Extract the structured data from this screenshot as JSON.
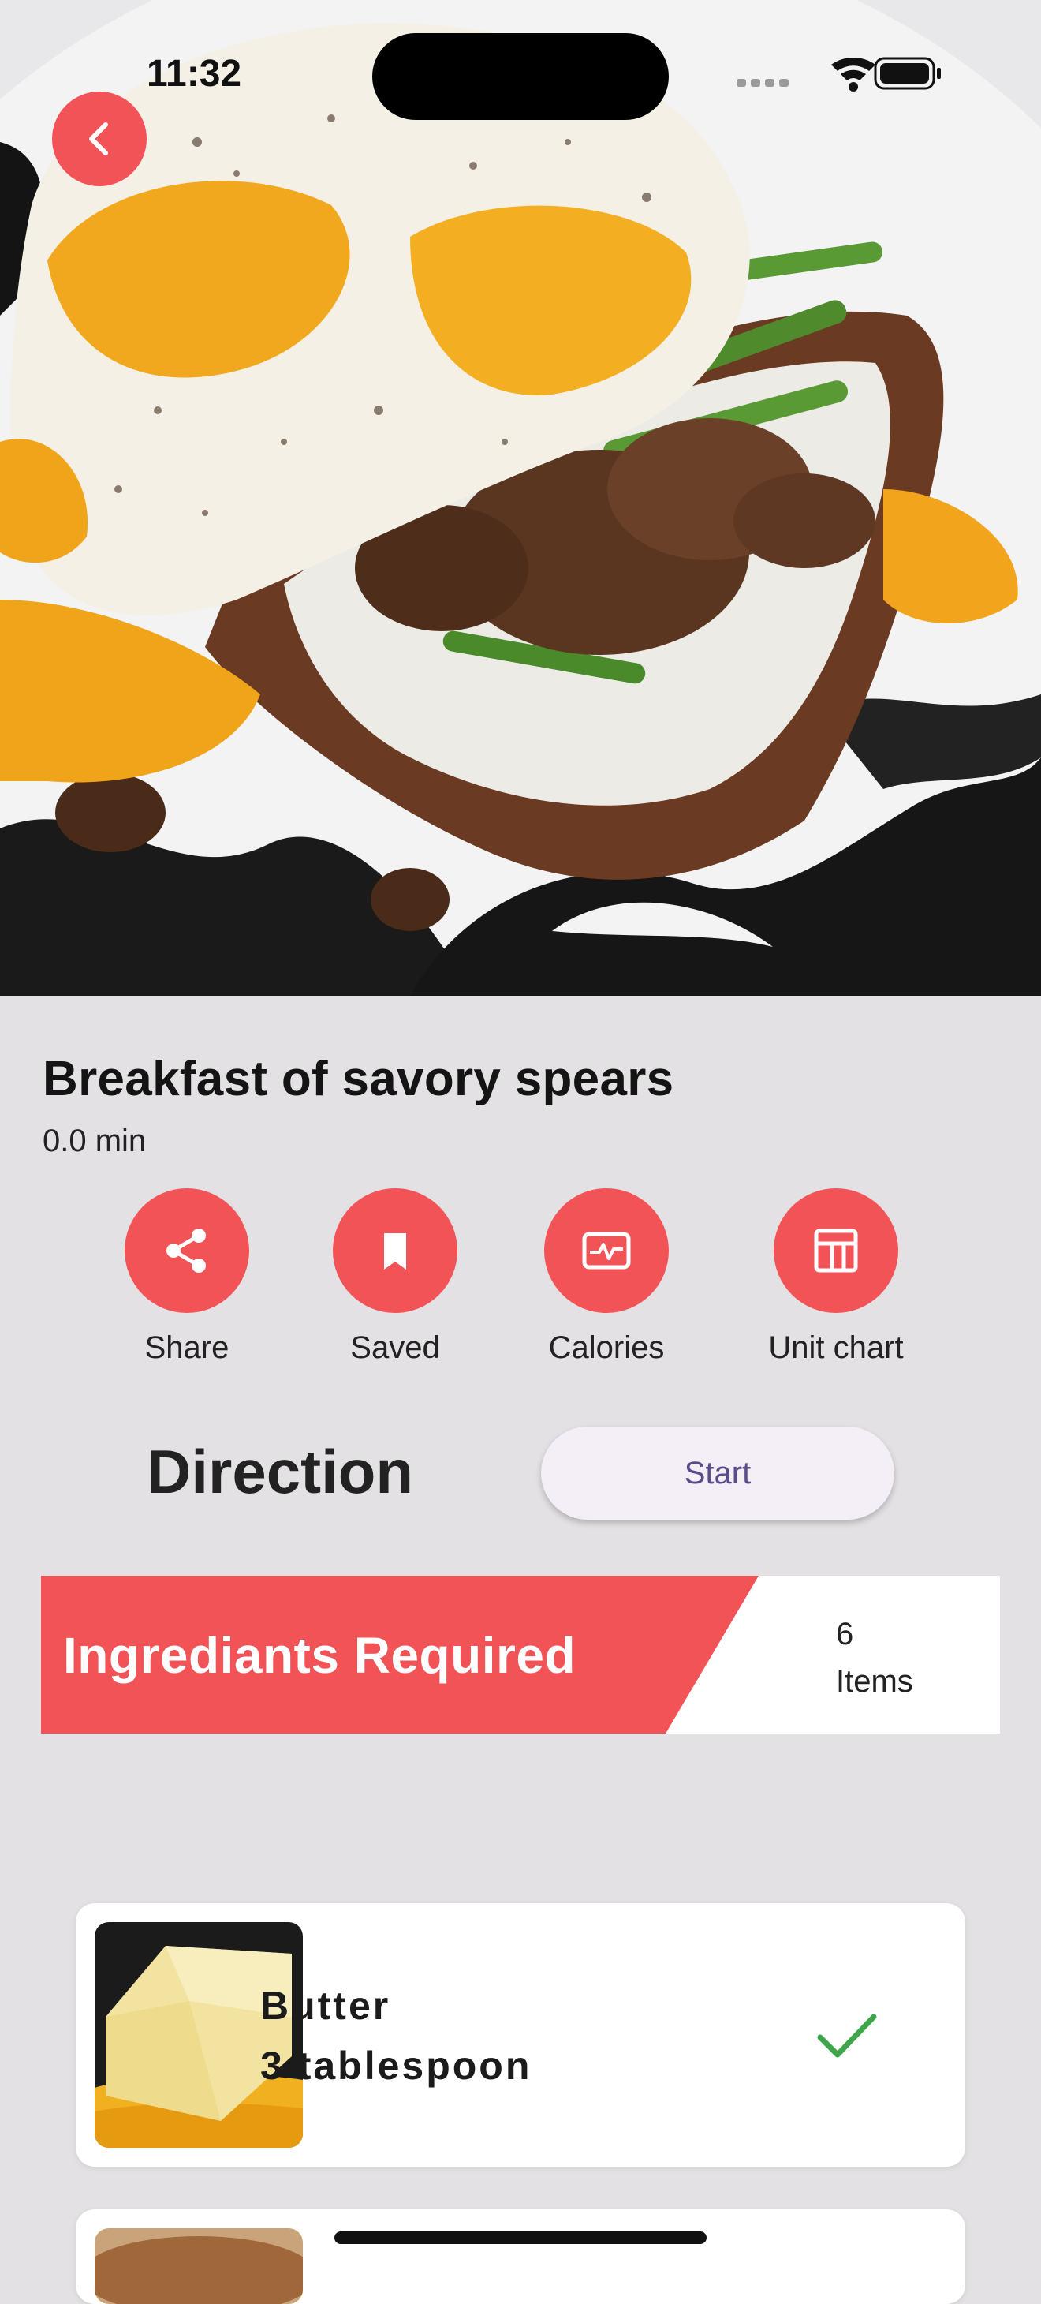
{
  "status_bar": {
    "time": "11:32"
  },
  "recipe": {
    "title": "Breakfast of savory spears",
    "duration": "0.0 min"
  },
  "actions": [
    {
      "label": "Share",
      "icon": "share-icon"
    },
    {
      "label": "Saved",
      "icon": "bookmark-icon"
    },
    {
      "label": "Calories",
      "icon": "pulse-card-icon"
    },
    {
      "label": "Unit chart",
      "icon": "table-chart-icon"
    }
  ],
  "direction": {
    "heading": "Direction",
    "start_label": "Start"
  },
  "ingredients": {
    "banner_title": "Ingrediants Required",
    "count": "6",
    "count_unit": "Items",
    "items": [
      {
        "name": "Butter",
        "quantity": "3 tablespoon",
        "checked": true
      }
    ]
  },
  "colors": {
    "accent": "#f25357",
    "check": "#3ea64a",
    "start_text": "#5b4b8a"
  }
}
